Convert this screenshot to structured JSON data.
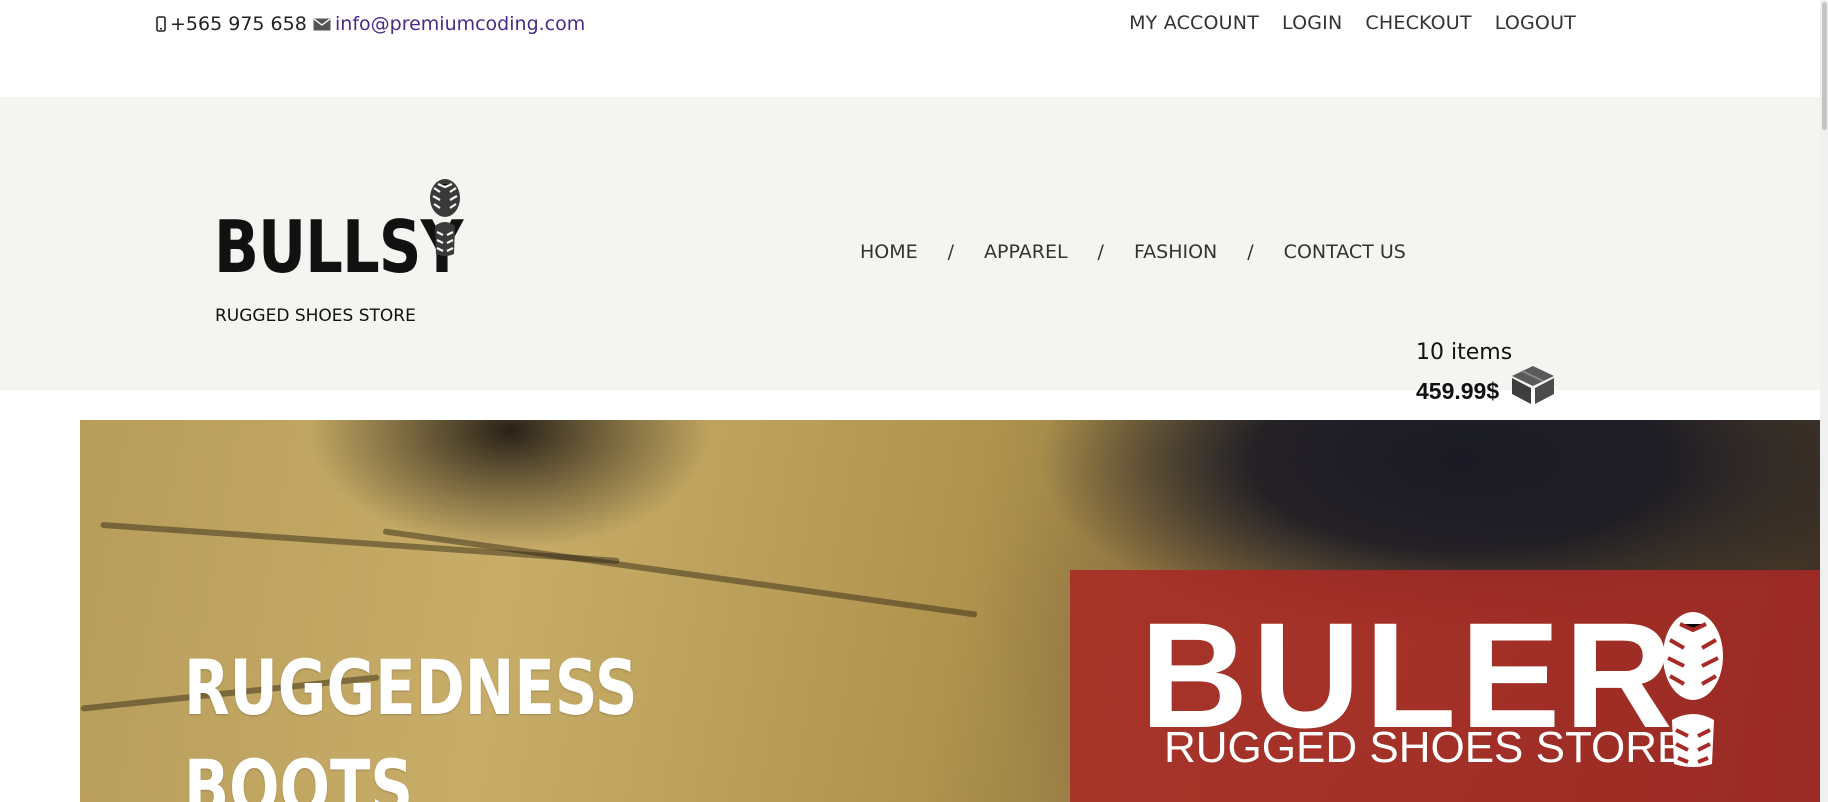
{
  "topbar": {
    "phone": "+565 975 658",
    "email": "info@premiumcoding.com",
    "links": [
      "MY ACCOUNT",
      "LOGIN",
      "CHECKOUT",
      "LOGOUT"
    ]
  },
  "header": {
    "logo_title": "BULLSY",
    "logo_subtitle": "RUGGED SHOES STORE",
    "nav": [
      "HOME",
      "APPAREL",
      "FASHION",
      "CONTACT US"
    ],
    "nav_separator": "/",
    "cart_count": "10 items",
    "cart_total": "459.99$"
  },
  "hero": {
    "title_line1": "RUGGEDNESS",
    "title_line2": "BOOTS",
    "promo_brand": "BULER",
    "promo_subtitle": "RUGGED SHOES STORE"
  },
  "icons": {
    "phone": "mobile-phone-icon",
    "email": "envelope-icon",
    "cart": "box-icon",
    "logo": "boot-print-icon"
  },
  "colors": {
    "email_link": "#4a2a8a",
    "header_bg": "#f4f4f0",
    "promo_bg": "#a82a26"
  }
}
